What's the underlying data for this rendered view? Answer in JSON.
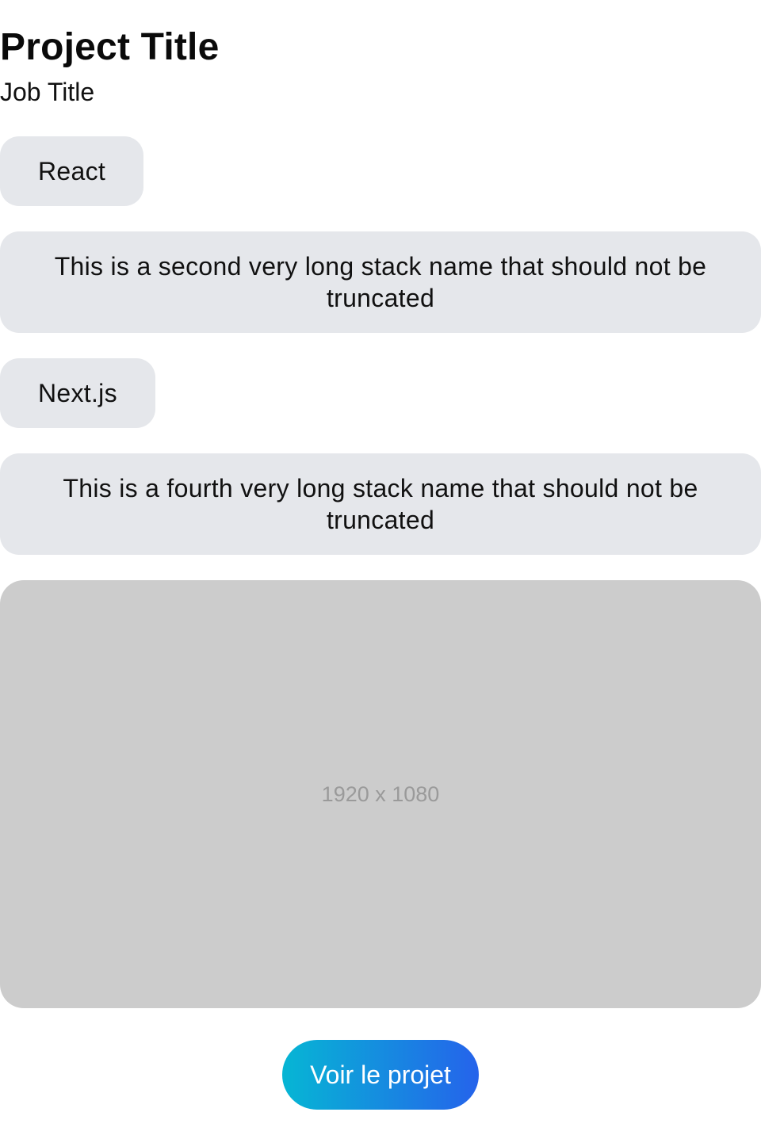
{
  "project": {
    "title": "Project Title",
    "job_title": "Job Title"
  },
  "stacks": [
    {
      "label": "React"
    },
    {
      "label": "This is a second very long stack name that should not be truncated"
    },
    {
      "label": "Next.js"
    },
    {
      "label": "This is a fourth very long stack name that should not be truncated"
    }
  ],
  "media": {
    "placeholder_label": "1920 x 1080"
  },
  "cta": {
    "label": "Voir le projet"
  },
  "colors": {
    "chip_background": "#e5e7eb",
    "image_placeholder": "#cccccc",
    "button_gradient_start": "#06b6d4",
    "button_gradient_end": "#2563eb"
  }
}
